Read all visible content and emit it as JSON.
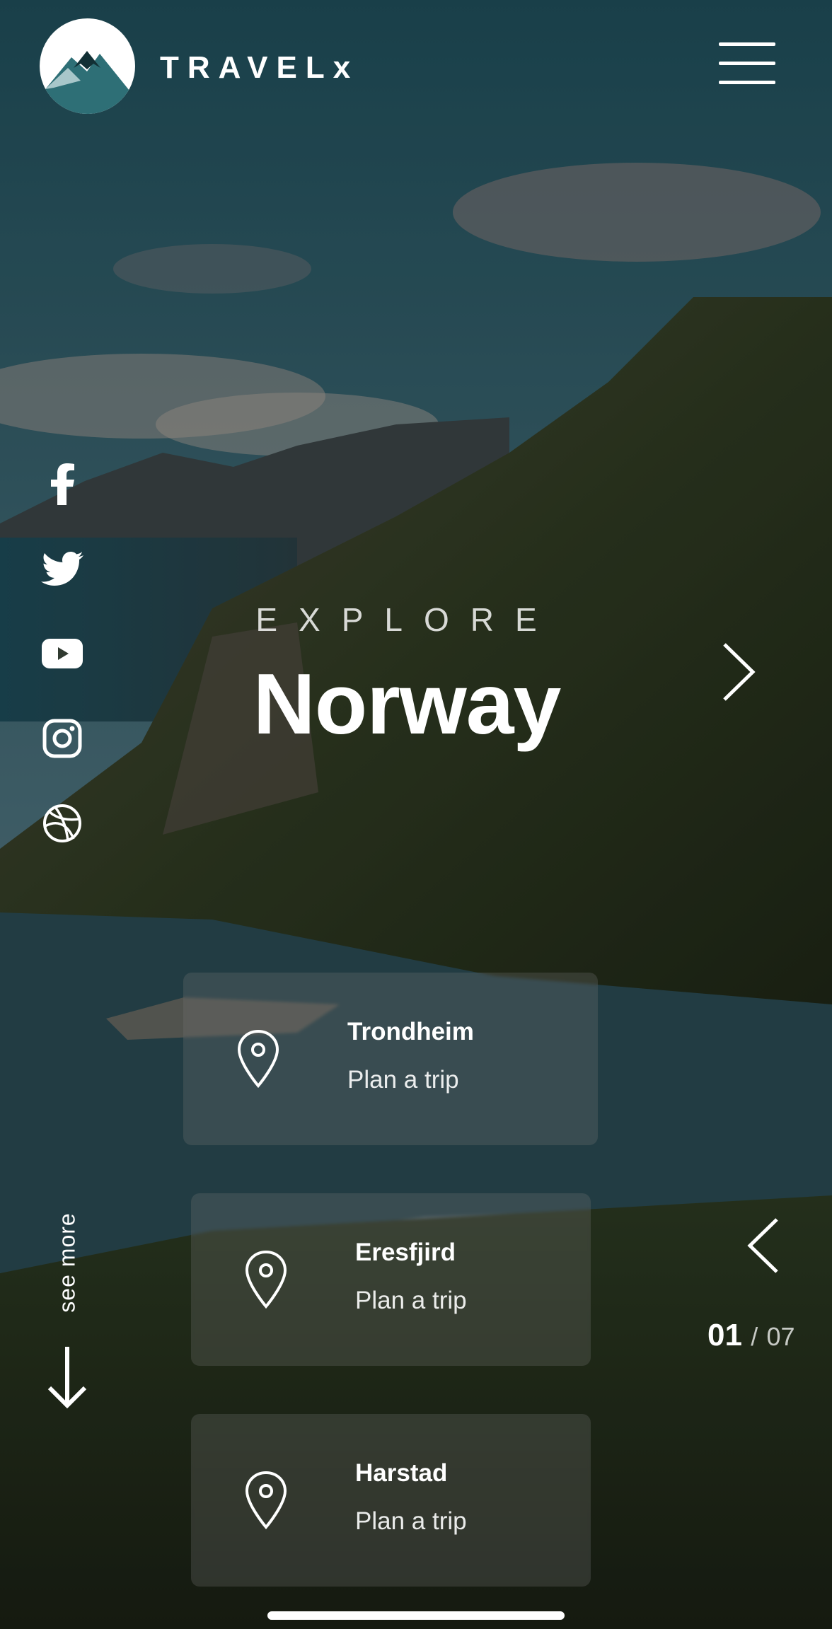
{
  "header": {
    "brand": "TRAVELx",
    "logo_icon": "mountain-logo-icon",
    "menu_icon": "hamburger-menu-icon"
  },
  "social": [
    {
      "name": "facebook-icon"
    },
    {
      "name": "twitter-icon"
    },
    {
      "name": "youtube-icon"
    },
    {
      "name": "instagram-icon"
    },
    {
      "name": "dribbble-icon"
    }
  ],
  "hero": {
    "kicker": "EXPLORE",
    "title": "Norway"
  },
  "destinations": [
    {
      "name": "Trondheim",
      "action": "Plan a trip"
    },
    {
      "name": "Eresfjird",
      "action": "Plan a trip"
    },
    {
      "name": "Harstad",
      "action": "Plan a trip"
    }
  ],
  "see_more": "see more",
  "pager": {
    "current": "01",
    "separator": "/",
    "total": "07"
  },
  "colors": {
    "text": "#ffffff",
    "card": "rgba(120,120,120,0.28)"
  }
}
